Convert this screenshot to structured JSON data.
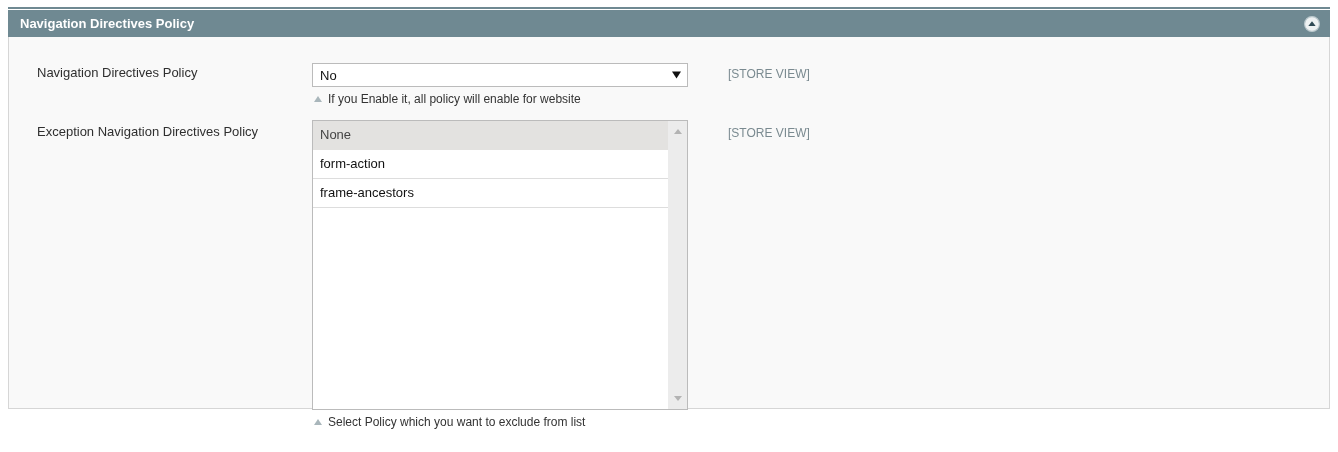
{
  "section": {
    "title": "Navigation Directives Policy",
    "expanded": true
  },
  "fields": [
    {
      "kind": "select",
      "label": "Navigation Directives Policy",
      "value": "No",
      "hint": "If you Enable it, all policy will enable for website",
      "scope": "[STORE VIEW]"
    },
    {
      "kind": "multiselect",
      "label": "Exception Navigation Directives Policy",
      "options": [
        {
          "label": "None",
          "selected": true
        },
        {
          "label": "form-action",
          "selected": false
        },
        {
          "label": "frame-ancestors",
          "selected": false
        }
      ],
      "hint": "Select Policy which you want to exclude from list",
      "scope": "[STORE VIEW]"
    }
  ]
}
